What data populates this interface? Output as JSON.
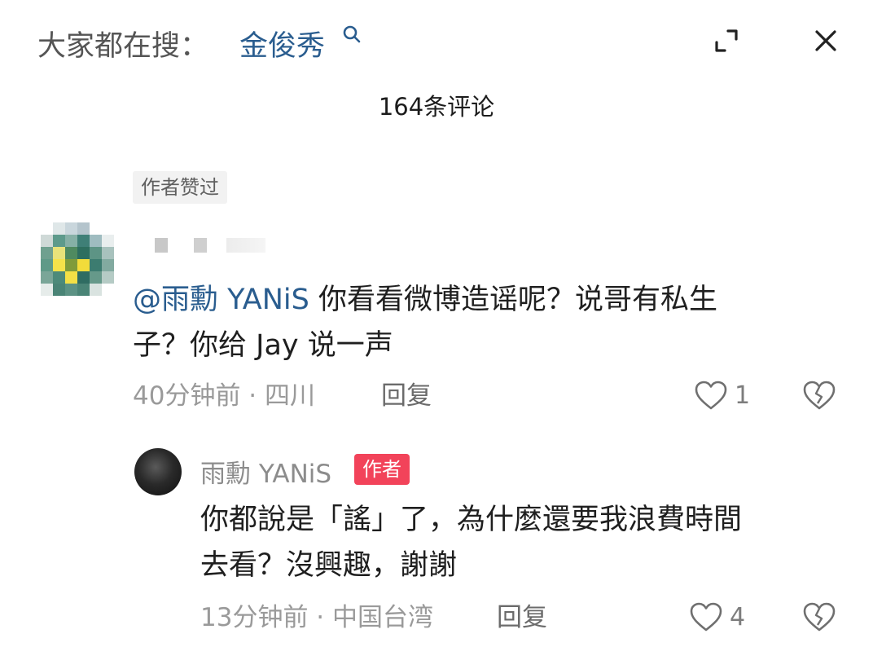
{
  "header": {
    "search_prefix": "大家都在搜：",
    "search_term": "金俊秀",
    "icons": {
      "search": "search-icon",
      "expand": "expand-icon",
      "close": "close-icon"
    }
  },
  "comments_header": {
    "count_label": "164条评论"
  },
  "comment": {
    "author_liked_label": "作者赞过",
    "mention": "@雨勳 YANiS",
    "text_line1": " 你看看微博造谣呢？说哥有私生",
    "text_line2": "子？你给 Jay 说一声",
    "time_location": "40分钟前 · 四川",
    "reply_label": "回复",
    "like_count": "1"
  },
  "reply": {
    "username": "雨勳 YANiS",
    "author_badge": "作者",
    "text_line1": "你都說是「謠」了，為什麼還要我浪費時間",
    "text_line2": "去看？沒興趣，謝謝",
    "time_location": "13分钟前 · 中国台湾",
    "reply_label": "回复",
    "like_count": "4"
  },
  "colors": {
    "link": "#2a5d8f",
    "author_badge_bg": "#f2435a",
    "muted_text": "#9a9a9a",
    "badge_bg": "#f2f2f2"
  }
}
